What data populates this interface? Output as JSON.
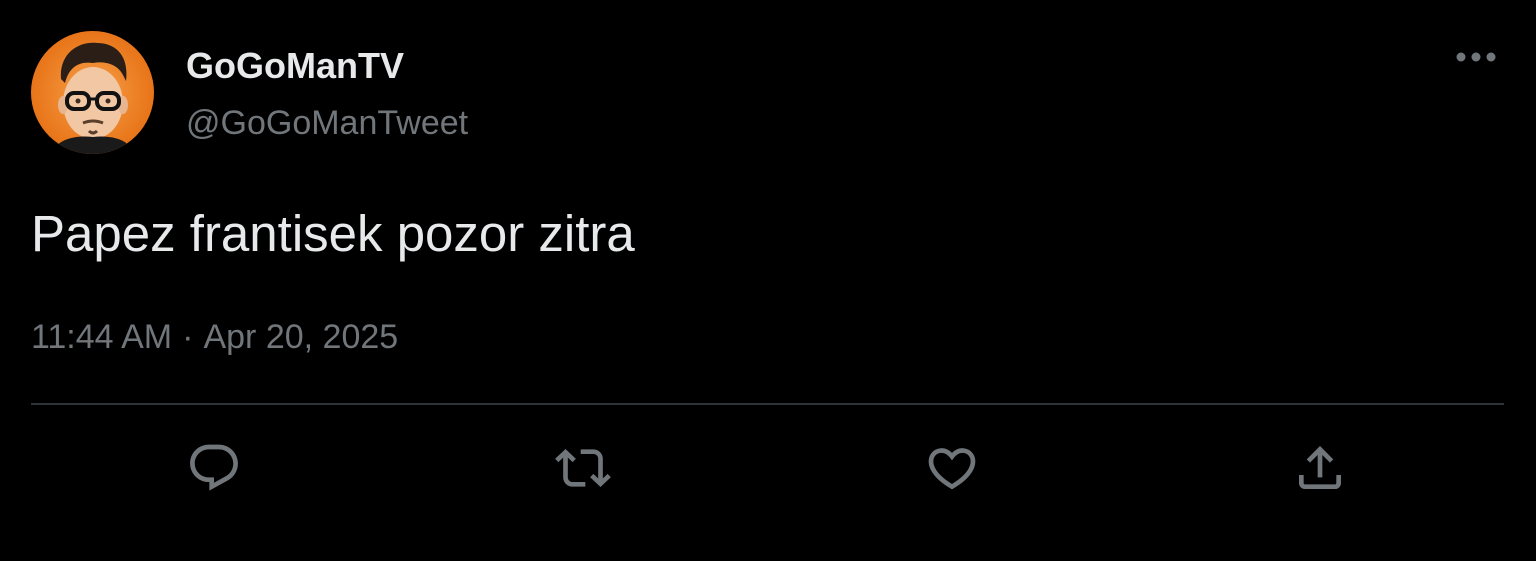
{
  "tweet": {
    "author": {
      "display_name": "GoGoManTV",
      "handle": "@GoGoManTweet",
      "avatar_icon": "profile-avatar"
    },
    "text": "Papez frantisek pozor zitra",
    "time": "11:44 AM",
    "separator": "·",
    "date": "Apr 20, 2025"
  },
  "actions": [
    {
      "name": "reply",
      "icon": "reply-icon"
    },
    {
      "name": "retweet",
      "icon": "retweet-icon"
    },
    {
      "name": "like",
      "icon": "heart-icon"
    },
    {
      "name": "share",
      "icon": "share-icon"
    }
  ],
  "colors": {
    "background": "#000000",
    "primary_text": "#e7e9ea",
    "secondary_text": "#71767b",
    "divider": "#2f3336",
    "avatar_bg": "#f07a1a"
  }
}
